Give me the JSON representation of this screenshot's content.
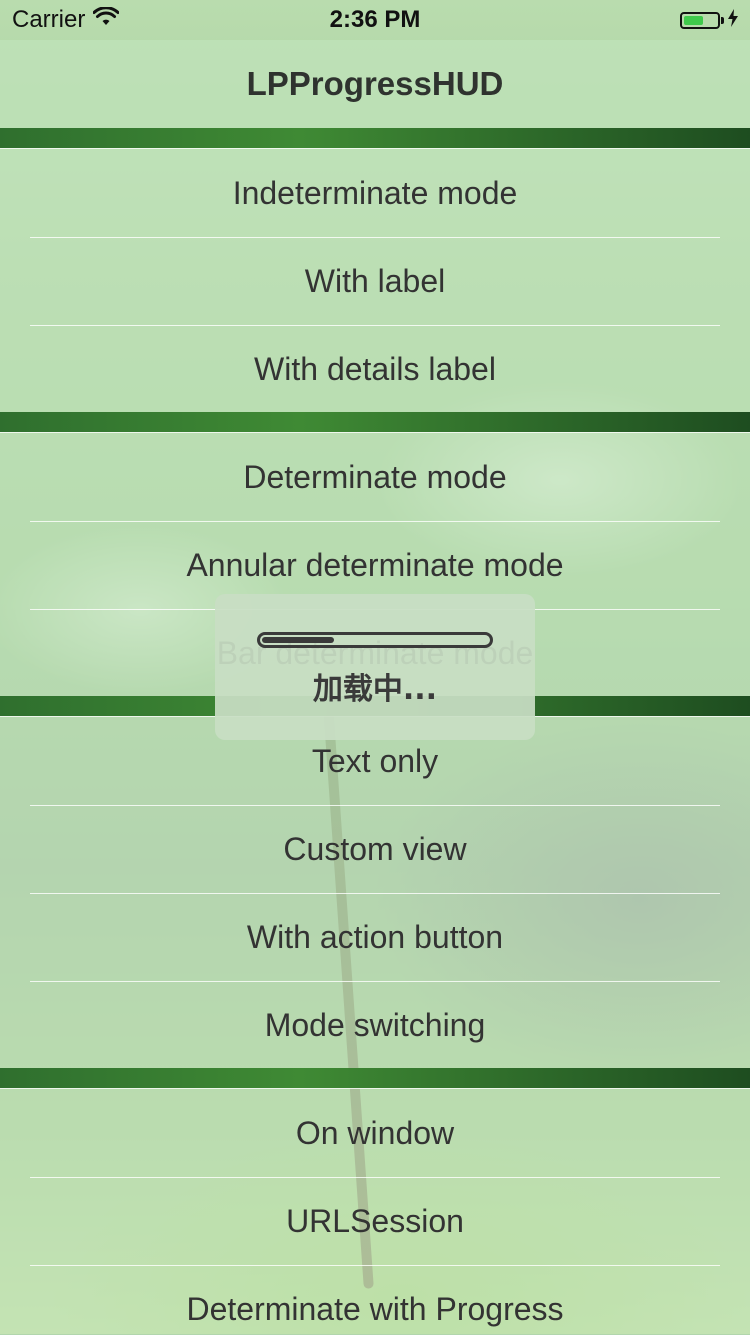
{
  "status_bar": {
    "carrier": "Carrier",
    "time": "2:36 PM",
    "battery_level": 0.6,
    "wifi_icon": "wifi-icon",
    "charging_icon": "bolt-icon"
  },
  "nav": {
    "title": "LPProgressHUD"
  },
  "sections": [
    {
      "rows": [
        "Indeterminate mode",
        "With label",
        "With details label"
      ]
    },
    {
      "rows": [
        "Determinate mode",
        "Annular determinate mode",
        "Bar determinate mode"
      ]
    },
    {
      "rows": [
        "Text only",
        "Custom view",
        "With action button",
        "Mode switching"
      ]
    },
    {
      "rows": [
        "On window",
        "URLSession",
        "Determinate with Progress"
      ]
    }
  ],
  "hud": {
    "label": "加载中...",
    "progress": 0.32
  },
  "colors": {
    "accent_green": "#3f8a34",
    "battery_green": "#3fc94b",
    "text": "#333333"
  }
}
